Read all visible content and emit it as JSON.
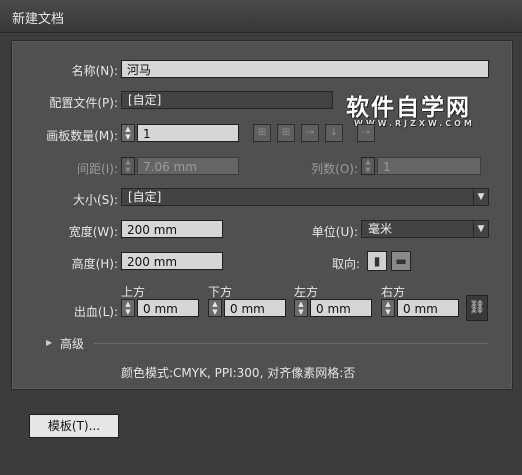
{
  "window": {
    "title": "新建文档"
  },
  "fields": {
    "name": {
      "label": "名称(N):",
      "value": "河马"
    },
    "profile": {
      "label": "配置文件(P):",
      "value": "[自定]"
    },
    "artboards": {
      "label": "画板数量(M):",
      "value": "1"
    },
    "spacing": {
      "label": "间距(I):",
      "value": "7.06 mm"
    },
    "columns": {
      "label": "列数(O):",
      "value": "1"
    },
    "size": {
      "label": "大小(S):",
      "value": "[自定]"
    },
    "width": {
      "label": "宽度(W):",
      "value": "200 mm"
    },
    "units": {
      "label": "单位(U):",
      "value": "毫米"
    },
    "height": {
      "label": "高度(H):",
      "value": "200 mm"
    },
    "orientation": {
      "label": "取向:"
    },
    "bleed": {
      "label": "出血(L):",
      "top": {
        "label": "上方",
        "value": "0 mm"
      },
      "bottom": {
        "label": "下方",
        "value": "0 mm"
      },
      "left": {
        "label": "左方",
        "value": "0 mm"
      },
      "right": {
        "label": "右方",
        "value": "0 mm"
      }
    }
  },
  "advanced": {
    "label": "高级"
  },
  "info": {
    "text": "颜色模式:CMYK, PPI:300, 对齐像素网格:否"
  },
  "buttons": {
    "templates": "模板(T)..."
  },
  "watermark": {
    "main": "软件自学网",
    "sub": "WWW.RJZXW.COM"
  },
  "icons": {
    "layout": [
      "grid-by-row-icon",
      "grid-by-column-icon",
      "arrange-by-row-icon",
      "arrange-by-column-icon",
      "right-to-left-icon"
    ],
    "orientation": [
      "portrait-icon",
      "landscape-icon"
    ],
    "link": "chain-link-icon"
  }
}
